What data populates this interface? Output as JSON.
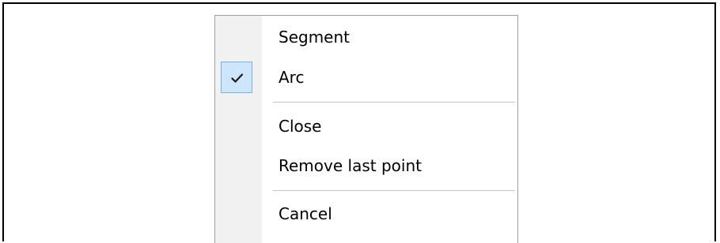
{
  "menu": {
    "items": [
      {
        "label": "Segment",
        "checked": false
      },
      {
        "label": "Arc",
        "checked": true,
        "icon": "checkmark-icon"
      },
      {
        "label": "Close",
        "checked": false
      },
      {
        "label": "Remove last point",
        "checked": false
      },
      {
        "label": "Cancel",
        "checked": false
      }
    ]
  },
  "colors": {
    "gutter": "#f1f1f1",
    "check_highlight": "#cde6fb",
    "check_border": "#7ab0e8",
    "separator": "#c4c4c4",
    "menu_border": "#a0a0a0",
    "frame_border": "#000000"
  }
}
